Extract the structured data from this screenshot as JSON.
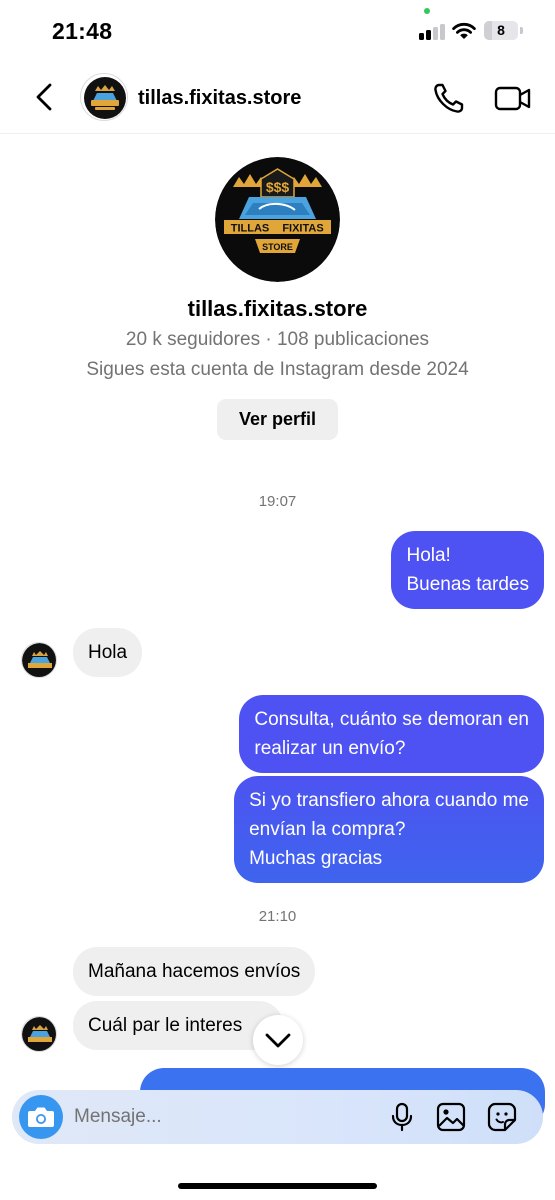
{
  "status_bar": {
    "time": "21:48",
    "battery": "8",
    "icons": [
      "cellular-signal-icon",
      "wifi-icon",
      "battery-icon"
    ]
  },
  "header": {
    "username": "tillas.fixitas.store",
    "icons": [
      "chevron-left-icon",
      "phone-icon",
      "video-camera-icon"
    ]
  },
  "profile": {
    "username": "tillas.fixitas.store",
    "stats": "20 k seguidores · 108 publicaciones",
    "since": "Sigues esta cuenta de Instagram desde 2024",
    "view_profile_label": "Ver perfil",
    "logo_text": [
      "$$$",
      "TILLAS",
      "FIXITAS",
      "STORE"
    ]
  },
  "conversation": {
    "timestamp_1": "19:07",
    "msg_1": [
      "Hola!",
      "Buenas tardes"
    ],
    "msg_2": "Hola",
    "msg_3": [
      "Consulta, cuánto se demoran en",
      "realizar un envío?"
    ],
    "msg_4": [
      "Si yo transfiero ahora cuando me",
      "envían la compra?",
      "Muchas gracias"
    ],
    "timestamp_2": "21:10",
    "msg_5": "Mañana hacemos envíos",
    "msg_6": "Cuál par le interes"
  },
  "composer": {
    "placeholder": "Mensaje...",
    "icons": [
      "camera-icon",
      "microphone-icon",
      "gallery-icon",
      "sticker-icon"
    ]
  },
  "colors": {
    "outgoing_bubble": "#4e52f2",
    "incoming_bubble": "#efefef",
    "secondary_text": "#737373",
    "camera_button": "#3797f0"
  }
}
